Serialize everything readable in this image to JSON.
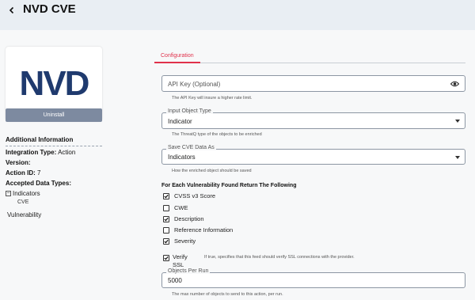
{
  "header": {
    "title": "NVD CVE"
  },
  "sidebar": {
    "logo_text": "NVD",
    "uninstall_label": "Uninstall",
    "info_title": "Additional Information",
    "integration_type_label": "Integration Type:",
    "integration_type_value": "Action",
    "version_label": "Version:",
    "action_id_label": "Action ID:",
    "action_id_value": "7",
    "accepted_label": "Accepted Data Types:",
    "tree_parent": "Indicators",
    "tree_child": "CVE",
    "vulnerability": "Vulnerability"
  },
  "tabs": [
    {
      "label": "Configuration",
      "active": true
    }
  ],
  "form": {
    "api_key": {
      "placeholder": "API Key (Optional)",
      "helper": "The API Key will insure a higher rate limit."
    },
    "input_type": {
      "label": "Input Object Type",
      "value": "Indicator",
      "helper": "The ThreatQ type of the objects to be enriched"
    },
    "save_as": {
      "label": "Save CVE Data As",
      "value": "Indicators",
      "helper": "How the enriched object should be saved"
    },
    "section_title": "For Each Vulnerability Found Return The Following",
    "options": [
      {
        "label": "CVSS v3 Score",
        "checked": true
      },
      {
        "label": "CWE",
        "checked": false
      },
      {
        "label": "Description",
        "checked": true
      },
      {
        "label": "Reference Information",
        "checked": false
      },
      {
        "label": "Severity",
        "checked": true
      }
    ],
    "verify_ssl": {
      "label": "Verify SSL",
      "checked": true,
      "helper": "If true, specifies that this feed should verify SSL connections with the provider."
    },
    "objects_per_run": {
      "label": "Objects Per Run",
      "value": "5000",
      "helper": "The max number of objects to send to this action, per run."
    }
  },
  "colors": {
    "accent": "#e0314b",
    "header_bg": "#e9eef3",
    "button": "#7d8aa0",
    "logo": "#1f3a6e"
  }
}
